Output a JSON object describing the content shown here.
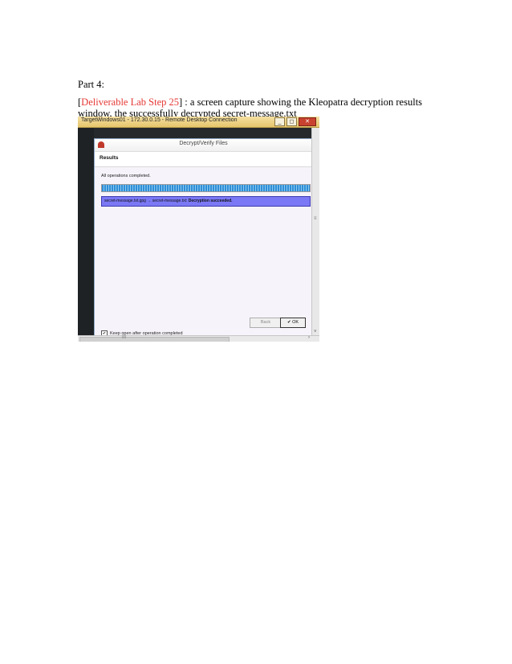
{
  "document": {
    "heading": "Part 4:",
    "caption_bracket_open": "[",
    "caption_link": "Deliverable Lab Step 25",
    "caption_rest": "] : a screen capture showing the Kleopatra decryption results window, the successfully decrypted secret-message.txt"
  },
  "rdp": {
    "title": "TargetWindows01 - 172.30.0.15 - Remote Desktop Connection",
    "minimize": "_",
    "restore": "◻",
    "close": "✕"
  },
  "dialog": {
    "title": "Decrypt/Verify Files",
    "results_header": "Results",
    "status": "All operations completed.",
    "progress": 1.0,
    "result_row_text": "secret-message.txt.gpg → secret-message.txt: ",
    "result_row_bold": "Decryption succeeded.",
    "keep_open_checked": true,
    "keep_open_check": "✔",
    "keep_open_label": "Keep open after operation completed",
    "back_button": "Back",
    "ok_button": "✔ OK"
  },
  "scrollbars": {
    "vertical_grip": "≡",
    "down_arrow": "˅",
    "horizontal_grip": "III",
    "right_arrow": "›"
  },
  "colors": {
    "link_red": "#e53935",
    "result_highlight": "#7b78f5",
    "progress_blue": "#2f8fd8"
  }
}
